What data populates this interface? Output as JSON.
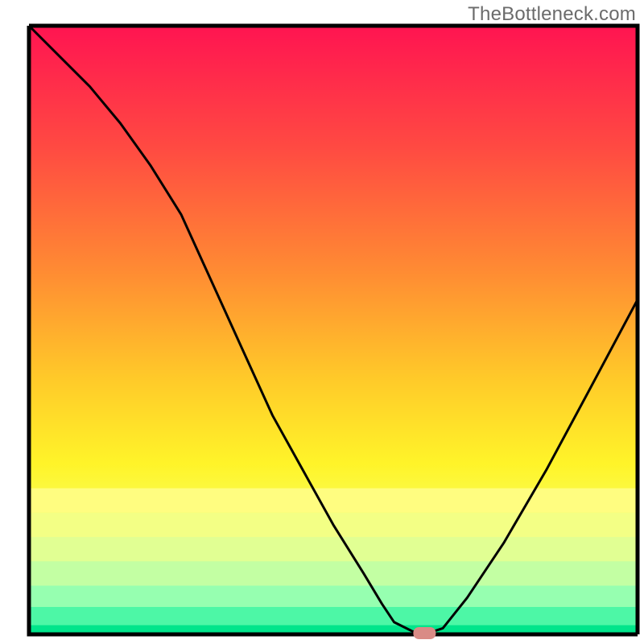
{
  "watermark": "TheBottleneck.com",
  "chart_data": {
    "type": "line",
    "title": "",
    "xlabel": "",
    "ylabel": "",
    "xlim": [
      0,
      100
    ],
    "ylim": [
      0,
      100
    ],
    "note": "Valley curve with minimum near x≈65; background is a vertical red→yellow→green gradient indicating bottleneck severity (top=bad, bottom=good). A small rounded marker sits at the valley floor.",
    "series": [
      {
        "name": "bottleneck-curve",
        "x": [
          0,
          5,
          10,
          15,
          20,
          25,
          30,
          35,
          40,
          45,
          50,
          55,
          58,
          60,
          63,
          65,
          68,
          72,
          78,
          85,
          92,
          100
        ],
        "y": [
          100,
          95,
          90,
          84,
          77,
          69,
          58,
          47,
          36,
          27,
          18,
          10,
          5,
          2,
          0.5,
          0,
          1,
          6,
          15,
          27,
          40,
          55
        ]
      }
    ],
    "marker": {
      "x": 65,
      "y": 0,
      "color": "#d98b86"
    },
    "gradient_stops": [
      {
        "pos": 0.0,
        "color": "#ff1451"
      },
      {
        "pos": 0.2,
        "color": "#ff4a42"
      },
      {
        "pos": 0.4,
        "color": "#ff8a33"
      },
      {
        "pos": 0.58,
        "color": "#ffca29"
      },
      {
        "pos": 0.72,
        "color": "#fff429"
      },
      {
        "pos": 0.82,
        "color": "#f6ff5e"
      },
      {
        "pos": 0.9,
        "color": "#d7ff9a"
      },
      {
        "pos": 0.96,
        "color": "#8effb0"
      },
      {
        "pos": 1.0,
        "color": "#00e58b"
      }
    ],
    "axis_color": "#000000"
  }
}
